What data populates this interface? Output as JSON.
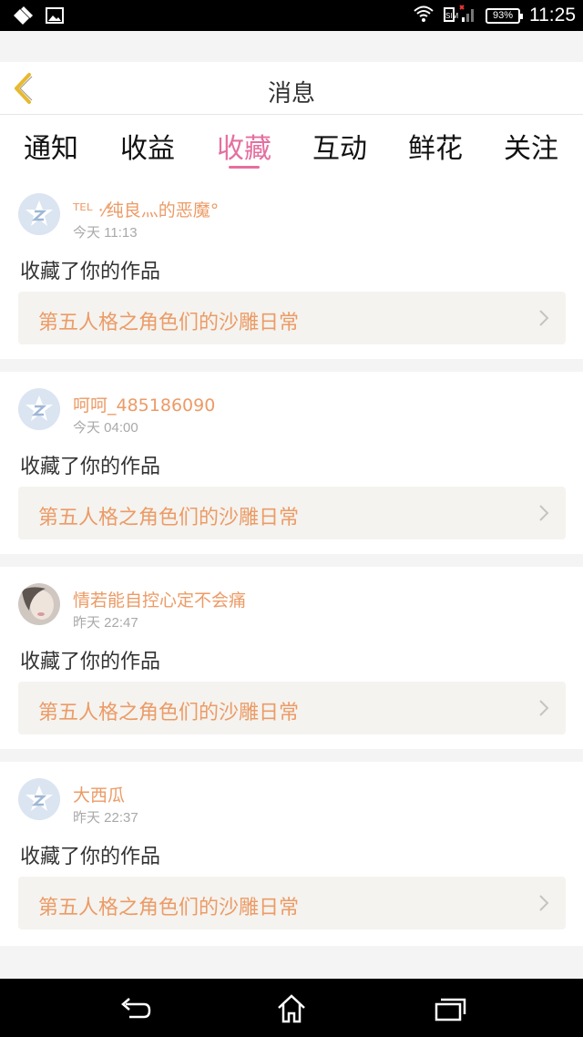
{
  "status_bar": {
    "battery": "93%",
    "time": "11:25"
  },
  "header": {
    "title": "消息"
  },
  "tabs": [
    {
      "label": "通知",
      "active": false
    },
    {
      "label": "收益",
      "active": false
    },
    {
      "label": "收藏",
      "active": true
    },
    {
      "label": "互动",
      "active": false
    },
    {
      "label": "鲜花",
      "active": false
    },
    {
      "label": "关注",
      "active": false
    }
  ],
  "notifications": [
    {
      "username": "ᵀᴱᴸ ·⁄纯良灬的恶魔°",
      "time": "今天 11:13",
      "action": "收藏了你的作品",
      "work_title": "第五人格之角色们的沙雕日常",
      "avatar": "default-star-avatar"
    },
    {
      "username": "呵呵_485186090",
      "time": "今天 04:00",
      "action": "收藏了你的作品",
      "work_title": "第五人格之角色们的沙雕日常",
      "avatar": "default-star-avatar"
    },
    {
      "username": "情若能自控心定不会痛",
      "time": "昨天 22:47",
      "action": "收藏了你的作品",
      "work_title": "第五人格之角色们的沙雕日常",
      "avatar": "photo-avatar"
    },
    {
      "username": "大西瓜",
      "time": "昨天 22:37",
      "action": "收藏了你的作品",
      "work_title": "第五人格之角色们的沙雕日常",
      "avatar": "default-star-avatar"
    }
  ],
  "colors": {
    "accent": "#e56fa0",
    "name_orange": "#ec9b66",
    "back_arrow": "#e8b92e"
  }
}
